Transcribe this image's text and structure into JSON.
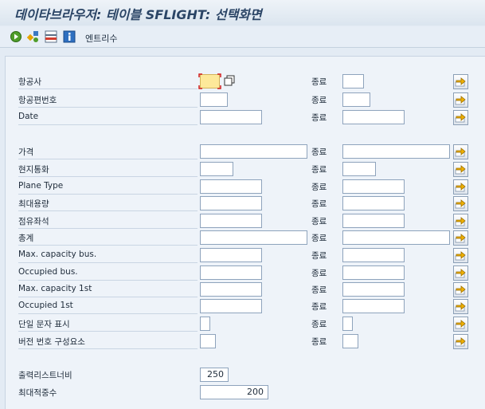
{
  "window": {
    "title": "데이타브라우저: 테이블 SFLIGHT: 선택화면"
  },
  "toolbar": {
    "icons": [
      "execute-icon",
      "selection-options-icon",
      "delete-row-icon",
      "info-icon"
    ],
    "entries_label": "엔트리수"
  },
  "selection": {
    "to_label": "종료",
    "rows": [
      {
        "label": "항공사",
        "from": "",
        "to": ""
      },
      {
        "label": "항공편번호",
        "from": "",
        "to": ""
      },
      {
        "label": "Date",
        "from": "",
        "to": ""
      },
      {
        "label": "가격",
        "from": "",
        "to": ""
      },
      {
        "label": "현지통화",
        "from": "",
        "to": ""
      },
      {
        "label": "Plane Type",
        "from": "",
        "to": ""
      },
      {
        "label": "최대용량",
        "from": "",
        "to": ""
      },
      {
        "label": "점유좌석",
        "from": "",
        "to": ""
      },
      {
        "label": "총계",
        "from": "",
        "to": ""
      },
      {
        "label": "Max. capacity bus.",
        "from": "",
        "to": ""
      },
      {
        "label": "Occupied bus.",
        "from": "",
        "to": ""
      },
      {
        "label": "Max. capacity 1st",
        "from": "",
        "to": ""
      },
      {
        "label": "Occupied 1st",
        "from": "",
        "to": ""
      },
      {
        "label": "단일 문자 표시",
        "from": "",
        "to": ""
      },
      {
        "label": "버전 번호 구성요소",
        "from": "",
        "to": ""
      }
    ]
  },
  "output": {
    "width_label": "출력리스트너비",
    "width_value": "250",
    "max_hits_label": "최대적중수",
    "max_hits_value": "200"
  },
  "colors": {
    "title": "#2b4566",
    "focus_field": "#fde99a",
    "arrow": "#e8a300"
  }
}
